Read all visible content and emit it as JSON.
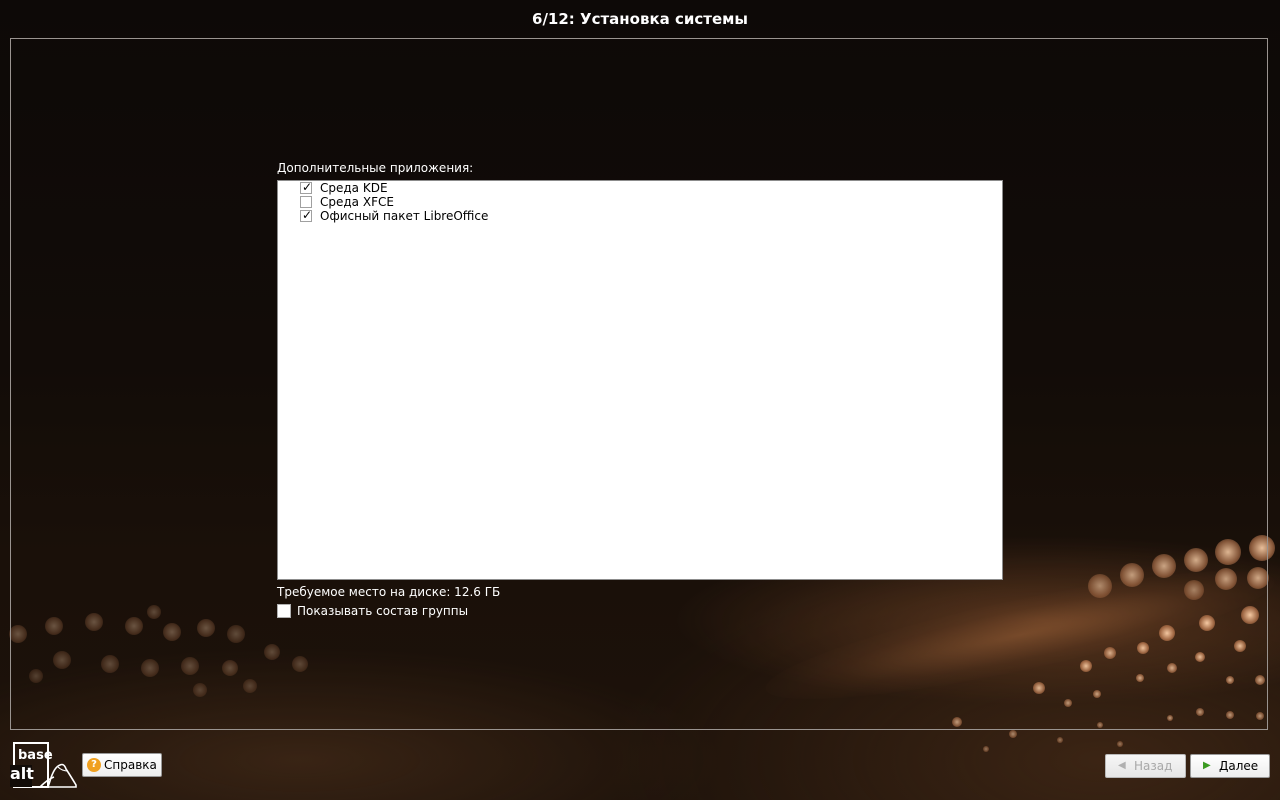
{
  "window": {
    "title": "6/12: Установка системы"
  },
  "main": {
    "section_label": "Дополнительные приложения:",
    "items": [
      {
        "label": "Среда KDE",
        "checked": true
      },
      {
        "label": "Среда XFCE",
        "checked": false
      },
      {
        "label": "Офисный пакет LibreOffice",
        "checked": true
      }
    ],
    "check_mark": "✓",
    "disk_space": "Требуемое место на диске: 12.6 ГБ",
    "show_group_label": "Показывать состав группы",
    "show_group_checked": false
  },
  "footer": {
    "logo_top": "base",
    "logo_bottom": "alt",
    "help_label": "Справка",
    "help_icon_glyph": "?",
    "back_label": "Назад",
    "next_label": "Далее",
    "back_icon": "chevron-left-icon",
    "next_icon": "chevron-right-icon"
  },
  "colors": {
    "background": "#120c08",
    "accent_next": "#3a9a20",
    "help_icon": "#f0a020"
  }
}
